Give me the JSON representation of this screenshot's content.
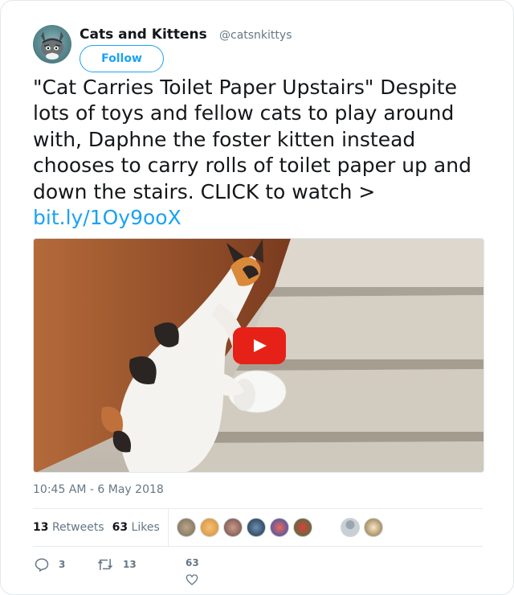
{
  "account": {
    "name": "Cats and Kittens",
    "handle": "@catsnkittys",
    "follow_label": "Follow"
  },
  "tweet": {
    "text": "\"Cat Carries Toilet Paper Upstairs\" Despite lots of toys and fellow cats to play around with, Daphne the foster kitten instead chooses to carry rolls of toilet paper up and down the stairs. CLICK to watch > ",
    "link": "bit.ly/1Oy9ooX",
    "timestamp": "10:45 AM - 6 May 2018"
  },
  "stats": {
    "retweets_count": "13",
    "retweets_label": "Retweets",
    "likes_count": "63",
    "likes_label": "Likes"
  },
  "actions": {
    "reply_count": "3",
    "retweet_count": "13",
    "like_count": "63"
  },
  "colors": {
    "accent": "#1da1f2",
    "muted": "#657786",
    "play": "#e62117"
  },
  "icons": [
    "reply-icon",
    "retweet-icon",
    "heart-icon",
    "play-icon"
  ]
}
